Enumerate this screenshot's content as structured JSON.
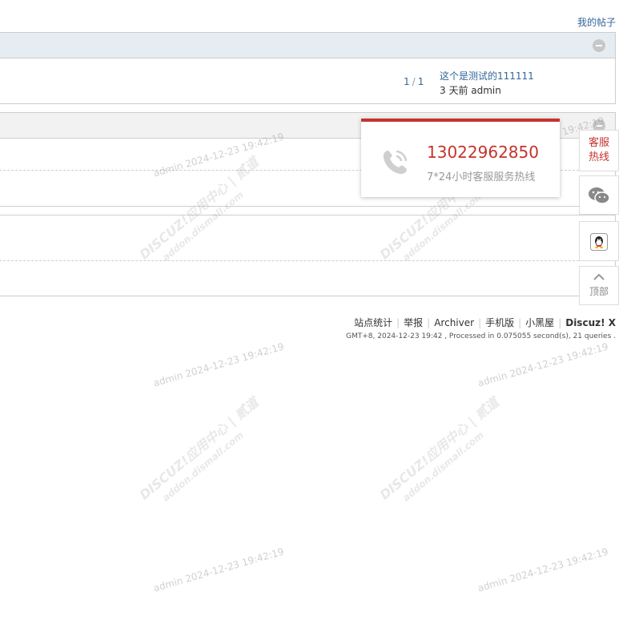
{
  "header": {
    "my_posts_link": "我的帖子"
  },
  "forum_panel": {
    "pager": {
      "current": "1",
      "separator": "/",
      "total": "1"
    },
    "last_post": {
      "title": "这个是测试的111111",
      "meta": "3 天前 admin"
    }
  },
  "footer": {
    "links": [
      "站点统计",
      "举报",
      "Archiver",
      "手机版",
      "小黑屋"
    ],
    "brand": "Discuz! X",
    "info": "GMT+8, 2024-12-23 19:42 , Processed in 0.075055 second(s), 21 queries ."
  },
  "hotline_popup": {
    "number": "13022962850",
    "description": "7*24小时客服服务热线"
  },
  "side_toolbar": {
    "hotline_label_1": "客服",
    "hotline_label_2": "热线",
    "top_label": "顶部"
  },
  "watermark": {
    "stamp": "admin 2024-12-23 19:42:19",
    "brand_line": "DISCUZ!应用中心 | 贰道",
    "url_line": "addon.dismall.com"
  },
  "colors": {
    "accent": "#c4332c",
    "link": "#336699",
    "panel_header": "#e5edf2"
  }
}
